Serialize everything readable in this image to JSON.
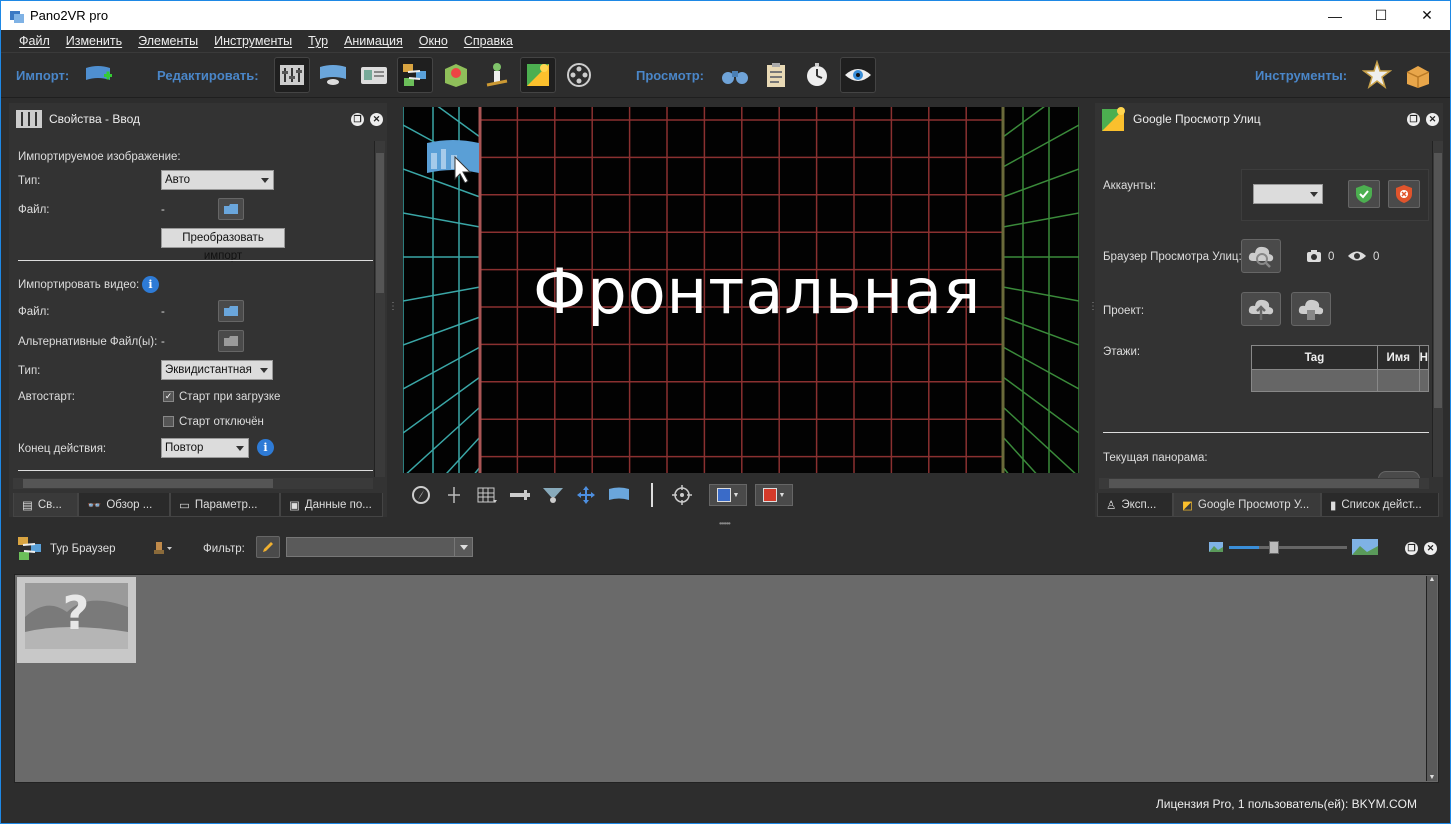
{
  "window": {
    "title": "Pano2VR pro",
    "minimize": "—",
    "maximize": "☐",
    "close": "✕"
  },
  "menu": [
    "Файл",
    "Изменить",
    "Элементы",
    "Инструменты",
    "Тур",
    "Анимация",
    "Окно",
    "Справка"
  ],
  "toolbar": {
    "import_label": "Импорт:",
    "edit_label": "Редактировать:",
    "view_label": "Просмотр:",
    "tools_label": "Инструменты:"
  },
  "left_panel": {
    "title": "Свойства - Ввод",
    "section_image": "Импортируемое изображение:",
    "type_label": "Тип:",
    "type_value": "Авто",
    "file_label": "Файл:",
    "file_value": "-",
    "convert_button": "Преобразовать импорт",
    "section_video": "Импортировать видео:",
    "video_file_label": "Файл:",
    "video_file_value": "-",
    "alt_files_label": "Альтернативные Файл(ы):",
    "alt_files_value": "-",
    "video_type_label": "Тип:",
    "video_type_value": "Эквидистантная",
    "autostart_label": "Автостарт:",
    "start_on_load": "Старт при загрузке",
    "start_disabled": "Старт отключён",
    "end_action_label": "Конец действия:",
    "end_action_value": "Повтор",
    "tabs": [
      "Св...",
      "Обзор ...",
      "Параметр...",
      "Данные по..."
    ]
  },
  "viewer": {
    "face_text": "Фронтальная"
  },
  "right_panel": {
    "title": "Google Просмотр Улиц",
    "accounts_label": "Аккаунты:",
    "browser_label": "Браузер Просмотра Улиц:",
    "photo_count": "0",
    "view_count": "0",
    "project_label": "Проект:",
    "floors_label": "Этажи:",
    "floors_columns": [
      "Tag",
      "Имя",
      "Н"
    ],
    "current_pano_label": "Текущая панорама:",
    "tabs": [
      "Эксп...",
      "Google Просмотр У...",
      "Список дейст..."
    ]
  },
  "tour_browser": {
    "title": "Тур Браузер",
    "filter_label": "Фильтр:",
    "filter_value": "",
    "zoom_level": 0.25
  },
  "status": {
    "license": "Лицензия Pro, 1 пользователь(ей): BKYM.COM"
  },
  "colors": {
    "accent": "#4a86c8",
    "grid_red": "#8a3030",
    "grid_teal": "#3aa6a6",
    "grid_green": "#3a8a3a",
    "window_border": "#1e88e5"
  }
}
